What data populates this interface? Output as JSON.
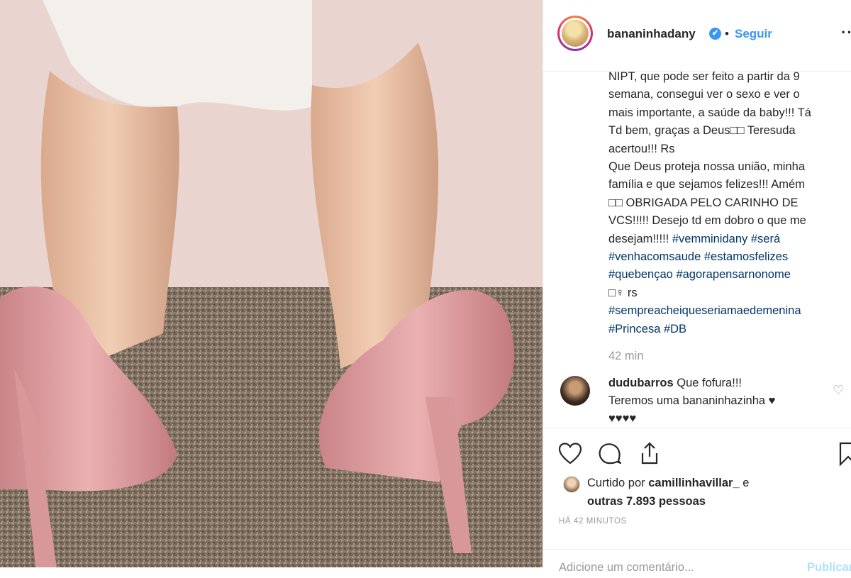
{
  "post": {
    "username": "bananinhadany",
    "verified_mark": "✔",
    "separator": "•",
    "follow_label": "Seguir",
    "more_label": "··",
    "caption_lines": [
      "NIPT, que pode ser feito a partir da 9",
      "semana, consegui ver o sexo e ver o",
      "mais importante, a saúde da baby!!! Tá",
      "Td bem, graças a Deus□□ Teresuda",
      "acertou!!! Rs",
      "Que Deus proteja nossa união, minha",
      "família e que sejamos felizes!!! Amém",
      "□□ OBRIGADA PELO CARINHO DE",
      "VCS!!!!! Desejo td em dobro o que me"
    ],
    "caption_last_prefix": "desejam!!!!! ",
    "hashtags_line1": [
      "#vemminidany",
      "#será"
    ],
    "hashtags_line2": [
      "#venhacomsaude",
      "#estamosfelizes"
    ],
    "hashtags_line3": [
      "#quebençao",
      "#agorapensarnonome"
    ],
    "emoji_rs": "□♀ rs",
    "hashtags_line5": [
      "#sempreacheiqueseriamaedemenina"
    ],
    "hashtags_line6": [
      "#Princesa",
      "#DB"
    ],
    "time_ago": "42 min"
  },
  "comment": {
    "user": "dudubarros",
    "text_line1": "Que fofura!!!",
    "text_line2": "Teremos uma bananinhazinha ♥",
    "text_line3": "♥♥♥♥"
  },
  "likes": {
    "prefix": "Curtido por",
    "user": "camillinhavillar_",
    "suffix": "e",
    "others": "outras 7.893 pessoas"
  },
  "posted_ago": "HÁ 42 MINUTOS",
  "add_comment": {
    "placeholder": "Adicione um comentário...",
    "publish_label": "Publicar"
  }
}
